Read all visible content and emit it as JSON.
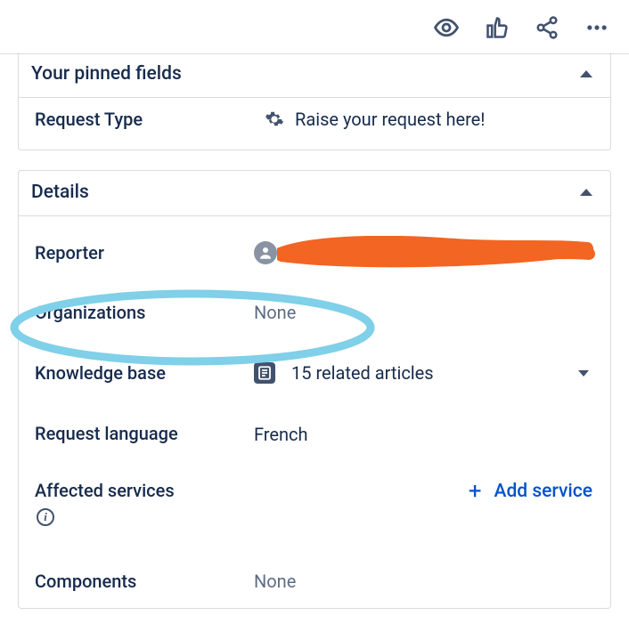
{
  "toolbar": {
    "watch_icon": "watch-icon",
    "like_icon": "thumbs-up-icon",
    "share_icon": "share-icon",
    "more_icon": "more-icon"
  },
  "pinned": {
    "header": "Your pinned fields",
    "request_type": {
      "label": "Request Type",
      "value": "Raise your request here!"
    }
  },
  "details": {
    "header": "Details",
    "reporter": {
      "label": "Reporter"
    },
    "organizations": {
      "label": "Organizations",
      "value": "None"
    },
    "knowledge_base": {
      "label": "Knowledge base",
      "value": "15 related articles"
    },
    "request_language": {
      "label": "Request language",
      "value": "French"
    },
    "affected_services": {
      "label": "Affected services",
      "add_label": "Add service"
    },
    "components": {
      "label": "Components",
      "value": "None"
    }
  }
}
